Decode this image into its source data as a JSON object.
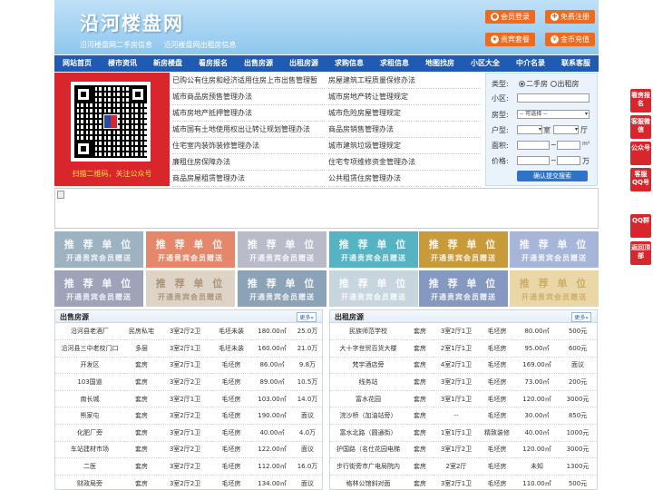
{
  "header": {
    "title": "沿河楼盘网",
    "sub_links": [
      "沿河楼盘网二手房信息",
      "沿河楼盘网出租房信息"
    ],
    "buttons": [
      {
        "label": "会员登录",
        "icon": "user-icon"
      },
      {
        "label": "免费注册",
        "icon": "register-icon"
      },
      {
        "label": "贵宾套餐",
        "icon": "vip-icon"
      },
      {
        "label": "金币充值",
        "icon": "coin-icon"
      }
    ]
  },
  "nav": [
    "网站首页",
    "楼市资讯",
    "新房楼盘",
    "看房报名",
    "出售房源",
    "出租房源",
    "求购信息",
    "求租信息",
    "地图找房",
    "小区大全",
    "中介名录",
    "联系客服"
  ],
  "qr": {
    "caption": "扫描二维码，关注公众号"
  },
  "links_left": [
    "已购公有住房和经济适用住房上市出售管理暂",
    "城市商品房预售管理办法",
    "城市房地产抵押管理办法",
    "城市国有土地使用权出让转让规划管理办法",
    "住宅室内装饰装修管理办法",
    "廉租住房保障办法",
    "商品房屋租赁管理办法"
  ],
  "links_right": [
    "房屋建筑工程质量保修办法",
    "城市房地产转让管理规定",
    "城市危险房屋管理规定",
    "商品房销售管理办法",
    "城市建筑垃圾管理规定",
    "住宅专项维修资金管理办法",
    "公共租赁住房管理办法"
  ],
  "search": {
    "type_label": "类型:",
    "type_options": [
      "二手房",
      "出租房"
    ],
    "community_label": "小区:",
    "housetype_label": "房型:",
    "housetype_value": "-- 可选择 --",
    "layout_label": "户型:",
    "room_unit": "室",
    "hall_unit": "厅",
    "area_label": "面积:",
    "area_sep": "~",
    "area_unit": "m²",
    "price_label": "价格:",
    "price_sep": "~",
    "price_unit": "万",
    "submit": "确认提交搜索"
  },
  "recommend": {
    "line1": "推 荐 单 位",
    "line2": "开通贵宾会员赠送"
  },
  "sale_panel": {
    "title": "出售房源",
    "more": "更多»",
    "rows": [
      [
        "沿河县老酒厂",
        "民房私宅",
        "3室2厅2卫",
        "毛坯未装",
        "180.00㎡",
        "25.0万"
      ],
      [
        "沿河县三中老校门口",
        "多层",
        "3室2厅1卫",
        "毛坯未装",
        "160.00㎡",
        "21.0万"
      ],
      [
        "开发区",
        "套房",
        "3室2厅1卫",
        "毛坯房",
        "86.00㎡",
        "9.8万"
      ],
      [
        "103国道",
        "套房",
        "3室2厅2卫",
        "毛坯房",
        "89.00㎡",
        "10.5万"
      ],
      [
        "南长城",
        "套房",
        "3室2厅1卫",
        "毛坯房",
        "103.00㎡",
        "14.0万"
      ],
      [
        "熊家屯",
        "套房",
        "3室2厅2卫",
        "毛坯房",
        "190.00㎡",
        "面议"
      ],
      [
        "化肥厂旁",
        "套房",
        "3室2厅1卫",
        "毛坯房",
        "40.00㎡",
        "4.0万"
      ],
      [
        "车站建材市场",
        "套房",
        "3室2厅2卫",
        "毛坯房",
        "122.00㎡",
        "面议"
      ],
      [
        "二医",
        "套房",
        "3室2厅2卫",
        "毛坯房",
        "112.00㎡",
        "16.0万"
      ],
      [
        "财政局旁",
        "套房",
        "3室2厅2卫",
        "毛坯房",
        "134.00㎡",
        "面议"
      ]
    ]
  },
  "rent_panel": {
    "title": "出租房源",
    "more": "更多»",
    "rows": [
      [
        "民族师范学校",
        "套房",
        "3室2厅1卫",
        "毛坯房",
        "80.00㎡",
        "500元"
      ],
      [
        "大十字世贸百货大楼",
        "套房",
        "2室1厅1卫",
        "毛坯房",
        "95.00㎡",
        "600元"
      ],
      [
        "梵宇酒店旁",
        "套房",
        "4室2厅1卫",
        "毛坯房",
        "169.00㎡",
        "面议"
      ],
      [
        "线务站",
        "套房",
        "3室2厅1卫",
        "毛坯房",
        "73.00㎡",
        "200元"
      ],
      [
        "富水花园",
        "套房",
        "3室1厅1卫",
        "毛坯房",
        "120.00㎡",
        "3000元"
      ],
      [
        "浣沙桥（加油站旁）",
        "套房",
        "--",
        "毛坯房",
        "30.00㎡",
        "850元"
      ],
      [
        "富水北路（圆通街）",
        "套房",
        "1室1厅1卫",
        "精致装修",
        "40.00㎡",
        "1000元"
      ],
      [
        "护国路（名仕花园电梯",
        "套房",
        "3室1厅2卫",
        "毛坯房",
        "120.00㎡",
        "3000元"
      ],
      [
        "步行街旁市广电局院内",
        "套房",
        "2室2厅",
        "毛坯房",
        "未知",
        "1300元"
      ],
      [
        "格林公馆斜对面",
        "套房",
        "3室2厅1卫",
        "毛坯房",
        "110.00㎡",
        "500元"
      ]
    ]
  },
  "float_buttons": [
    "看房报名",
    "客服微信",
    "公众号",
    "客服QQ号",
    "QQ群",
    "返回顶部"
  ],
  "colors": {
    "nav": "#1f5bb0",
    "accent": "#f06a1e",
    "red": "#d8262c"
  }
}
